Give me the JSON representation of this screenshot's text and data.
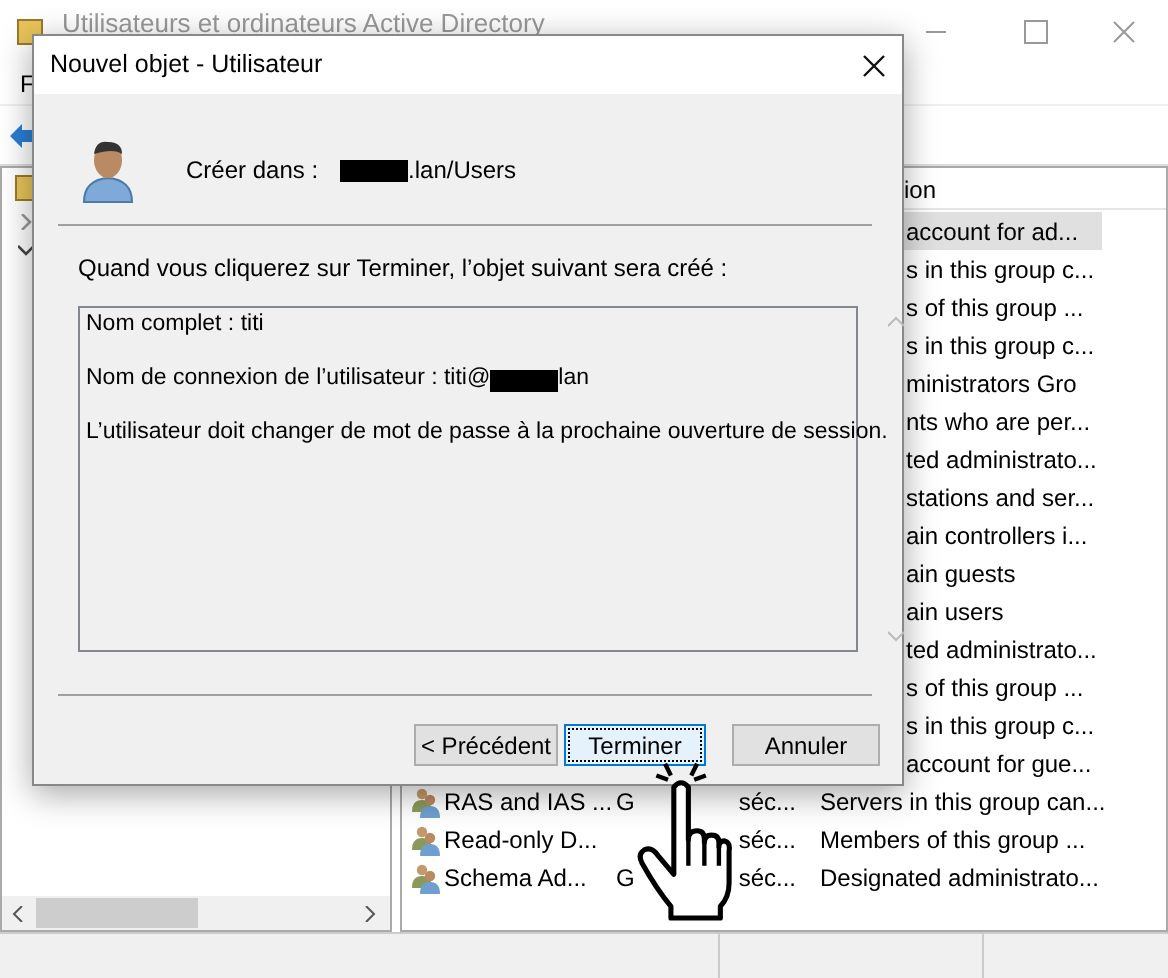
{
  "main_window": {
    "title": "Utilisateurs et ordinateurs Active Directory",
    "menu": [
      "F"
    ]
  },
  "tree": {
    "items": [
      {
        "expanded": false
      },
      {
        "expanded": true
      }
    ]
  },
  "list": {
    "header": "ion",
    "rows": [
      {
        "description": "account for ad...",
        "selected": true
      },
      {
        "description": "s in this group c...",
        "selected": false
      },
      {
        "description": "s of this group ...",
        "selected": false
      },
      {
        "description": "s in this group c...",
        "selected": false
      },
      {
        "description": "ministrators Gro",
        "selected": false
      },
      {
        "description": "nts who are per...",
        "selected": false
      },
      {
        "description": "ted administrato...",
        "selected": false
      },
      {
        "description": "stations and ser...",
        "selected": false
      },
      {
        "description": "ain controllers i...",
        "selected": false
      },
      {
        "description": "ain guests",
        "selected": false
      },
      {
        "description": "ain users",
        "selected": false
      },
      {
        "description": "ted administrato...",
        "selected": false
      },
      {
        "description": "s of this group ...",
        "selected": false
      },
      {
        "description": "s in this group c...",
        "selected": false
      },
      {
        "description": "account for gue...",
        "selected": false
      },
      {
        "name": "RAS and IAS ...",
        "type_start": "G",
        "type_end": "séc...",
        "description": "Servers in this group can...",
        "selected": false
      },
      {
        "name": "Read-only D...",
        "type_end": "séc...",
        "description": "Members of this group ...",
        "selected": false
      },
      {
        "name": "Schema Ad...",
        "type_start": "G",
        "type_end": "séc...",
        "description": "Designated administrato...",
        "selected": false
      }
    ]
  },
  "dialog": {
    "title": "Nouvel objet - Utilisateur",
    "created_in_label": "Créer dans :",
    "path": {
      "redacted": true,
      "after": ".lan/Users"
    },
    "intro": "Quand vous cliquerez sur Terminer, l’objet suivant sera créé :",
    "summary": [
      {
        "before": "Nom complet : titi"
      },
      {
        "before": "Nom de connexion de l’utilisateur : titi@",
        "redacted": true,
        "after": "lan"
      },
      {
        "before": "L’utilisateur doit changer de mot de passe à la prochaine ouverture de session."
      }
    ],
    "buttons": [
      {
        "label": "< Précédent",
        "focused": false
      },
      {
        "label": "Terminer",
        "focused": true
      },
      {
        "label": "Annuler",
        "focused": false
      }
    ]
  }
}
